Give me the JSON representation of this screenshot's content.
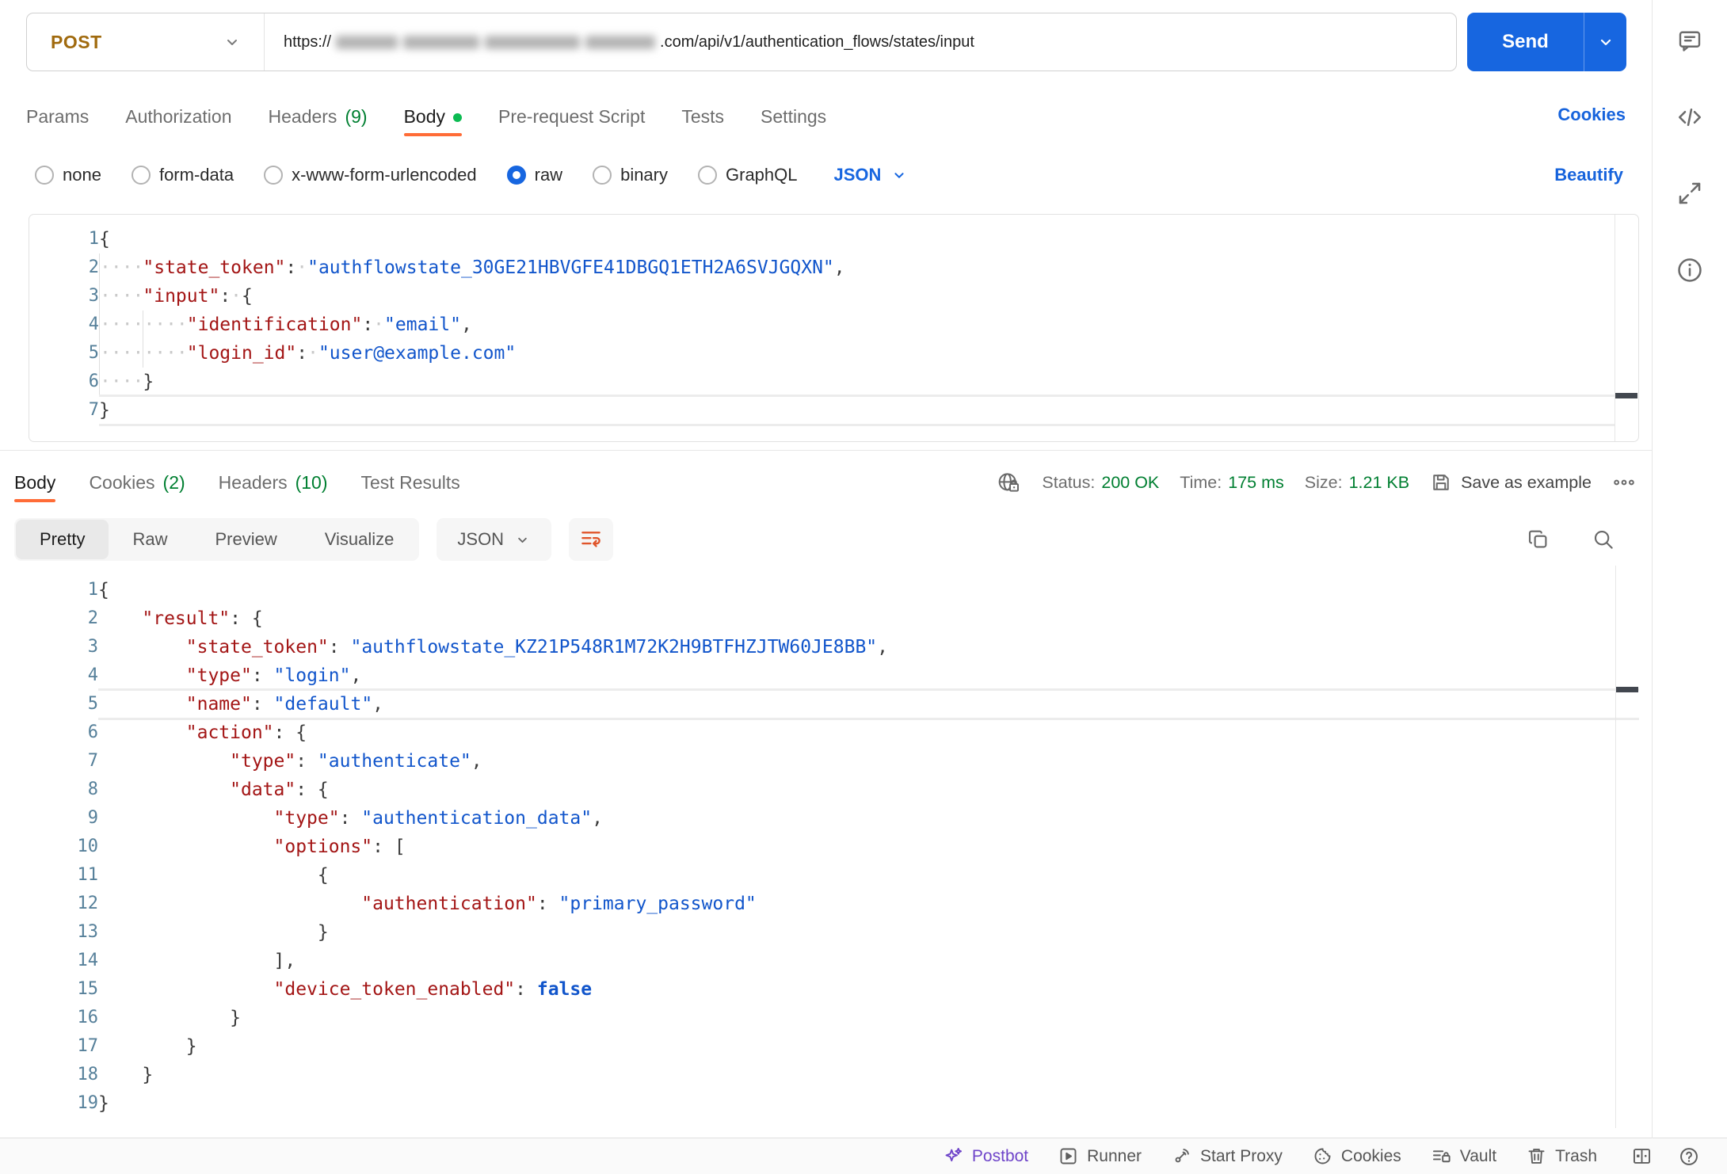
{
  "colors": {
    "accent_orange": "#FF6C37",
    "link_blue": "#1663DC",
    "send_blue": "#1766E0",
    "success_green": "#007F31",
    "method_post": "#A06A0E",
    "postbot_purple": "#6E44C9",
    "json_key_red": "#A31515",
    "json_string_blue": "#1155CB"
  },
  "request": {
    "method": "POST",
    "url_prefix": "https://",
    "url_suffix": ".com/api/v1/authentication_flows/states/input",
    "send_label": "Send",
    "cookies_link": "Cookies",
    "tabs": [
      {
        "label": "Params"
      },
      {
        "label": "Authorization"
      },
      {
        "label": "Headers",
        "count": "(9)"
      },
      {
        "label": "Body",
        "active": true,
        "dot": true
      },
      {
        "label": "Pre-request Script"
      },
      {
        "label": "Tests"
      },
      {
        "label": "Settings"
      }
    ],
    "body_modes": [
      {
        "label": "none"
      },
      {
        "label": "form-data"
      },
      {
        "label": "x-www-form-urlencoded"
      },
      {
        "label": "raw",
        "selected": true
      },
      {
        "label": "binary"
      },
      {
        "label": "GraphQL"
      }
    ],
    "language": "JSON",
    "beautify_label": "Beautify",
    "editor": {
      "show_dots": true,
      "current_line": 7,
      "lines": [
        {
          "n": 1,
          "indent": 0,
          "tokens": [
            [
              "p",
              "{"
            ]
          ]
        },
        {
          "n": 2,
          "indent": 1,
          "tokens": [
            [
              "k",
              "\"state_token\""
            ],
            [
              "p",
              ":"
            ],
            [
              "d",
              "·"
            ],
            [
              "s",
              "\"authflowstate_30GE21HBVGFE41DBGQ1ETH2A6SVJGQXN\""
            ],
            [
              "p",
              ","
            ]
          ]
        },
        {
          "n": 3,
          "indent": 1,
          "tokens": [
            [
              "k",
              "\"input\""
            ],
            [
              "p",
              ":"
            ],
            [
              "d",
              "·"
            ],
            [
              "p",
              "{"
            ]
          ]
        },
        {
          "n": 4,
          "indent": 2,
          "tokens": [
            [
              "k",
              "\"identification\""
            ],
            [
              "p",
              ":"
            ],
            [
              "d",
              "·"
            ],
            [
              "s",
              "\"email\""
            ],
            [
              "p",
              ","
            ]
          ]
        },
        {
          "n": 5,
          "indent": 2,
          "tokens": [
            [
              "k",
              "\"login_id\""
            ],
            [
              "p",
              ":"
            ],
            [
              "d",
              "·"
            ],
            [
              "s",
              "\"user@example.com\""
            ]
          ]
        },
        {
          "n": 6,
          "indent": 1,
          "tokens": [
            [
              "p",
              "}"
            ]
          ]
        },
        {
          "n": 7,
          "indent": 0,
          "tokens": [
            [
              "p",
              "}"
            ]
          ]
        }
      ]
    }
  },
  "response": {
    "tabs": [
      {
        "label": "Body",
        "active": true
      },
      {
        "label": "Cookies",
        "count": "(2)"
      },
      {
        "label": "Headers",
        "count": "(10)"
      },
      {
        "label": "Test Results"
      }
    ],
    "meta": {
      "status_label": "Status:",
      "status_value": "200 OK",
      "time_label": "Time:",
      "time_value": "175 ms",
      "size_label": "Size:",
      "size_value": "1.21 KB",
      "save_label": "Save as example"
    },
    "view_tabs": [
      {
        "label": "Pretty",
        "active": true
      },
      {
        "label": "Raw"
      },
      {
        "label": "Preview"
      },
      {
        "label": "Visualize"
      }
    ],
    "language": "JSON",
    "editor": {
      "show_dots": false,
      "current_line": 5,
      "lines": [
        {
          "n": 1,
          "indent": 0,
          "tokens": [
            [
              "p",
              "{"
            ]
          ]
        },
        {
          "n": 2,
          "indent": 1,
          "tokens": [
            [
              "k",
              "\"result\""
            ],
            [
              "p",
              ": {"
            ]
          ]
        },
        {
          "n": 3,
          "indent": 2,
          "tokens": [
            [
              "k",
              "\"state_token\""
            ],
            [
              "p",
              ": "
            ],
            [
              "s",
              "\"authflowstate_KZ21P548R1M72K2H9BTFHZJTW60JE8BB\""
            ],
            [
              "p",
              ","
            ]
          ]
        },
        {
          "n": 4,
          "indent": 2,
          "tokens": [
            [
              "k",
              "\"type\""
            ],
            [
              "p",
              ": "
            ],
            [
              "s",
              "\"login\""
            ],
            [
              "p",
              ","
            ]
          ]
        },
        {
          "n": 5,
          "indent": 2,
          "tokens": [
            [
              "k",
              "\"name\""
            ],
            [
              "p",
              ": "
            ],
            [
              "s",
              "\"default\""
            ],
            [
              "p",
              ","
            ]
          ]
        },
        {
          "n": 6,
          "indent": 2,
          "tokens": [
            [
              "k",
              "\"action\""
            ],
            [
              "p",
              ": {"
            ]
          ]
        },
        {
          "n": 7,
          "indent": 3,
          "tokens": [
            [
              "k",
              "\"type\""
            ],
            [
              "p",
              ": "
            ],
            [
              "s",
              "\"authenticate\""
            ],
            [
              "p",
              ","
            ]
          ]
        },
        {
          "n": 8,
          "indent": 3,
          "tokens": [
            [
              "k",
              "\"data\""
            ],
            [
              "p",
              ": {"
            ]
          ]
        },
        {
          "n": 9,
          "indent": 4,
          "tokens": [
            [
              "k",
              "\"type\""
            ],
            [
              "p",
              ": "
            ],
            [
              "s",
              "\"authentication_data\""
            ],
            [
              "p",
              ","
            ]
          ]
        },
        {
          "n": 10,
          "indent": 4,
          "tokens": [
            [
              "k",
              "\"options\""
            ],
            [
              "p",
              ": ["
            ]
          ]
        },
        {
          "n": 11,
          "indent": 5,
          "tokens": [
            [
              "p",
              "{"
            ]
          ]
        },
        {
          "n": 12,
          "indent": 6,
          "tokens": [
            [
              "k",
              "\"authentication\""
            ],
            [
              "p",
              ": "
            ],
            [
              "s",
              "\"primary_password\""
            ]
          ]
        },
        {
          "n": 13,
          "indent": 5,
          "tokens": [
            [
              "p",
              "}"
            ]
          ]
        },
        {
          "n": 14,
          "indent": 4,
          "tokens": [
            [
              "p",
              "],"
            ]
          ]
        },
        {
          "n": 15,
          "indent": 4,
          "tokens": [
            [
              "k",
              "\"device_token_enabled\""
            ],
            [
              "p",
              ": "
            ],
            [
              "b",
              "false"
            ]
          ]
        },
        {
          "n": 16,
          "indent": 3,
          "tokens": [
            [
              "p",
              "}"
            ]
          ]
        },
        {
          "n": 17,
          "indent": 2,
          "tokens": [
            [
              "p",
              "}"
            ]
          ]
        },
        {
          "n": 18,
          "indent": 1,
          "tokens": [
            [
              "p",
              "}"
            ]
          ]
        },
        {
          "n": 19,
          "indent": 0,
          "tokens": [
            [
              "p",
              "}"
            ]
          ]
        }
      ]
    }
  },
  "footer": {
    "items": [
      {
        "icon": "postbot-icon",
        "label": "Postbot",
        "accent": true
      },
      {
        "icon": "runner-icon",
        "label": "Runner"
      },
      {
        "icon": "start-proxy-icon",
        "label": "Start Proxy"
      },
      {
        "icon": "cookies-icon",
        "label": "Cookies"
      },
      {
        "icon": "vault-icon",
        "label": "Vault"
      },
      {
        "icon": "trash-icon",
        "label": "Trash"
      }
    ]
  }
}
